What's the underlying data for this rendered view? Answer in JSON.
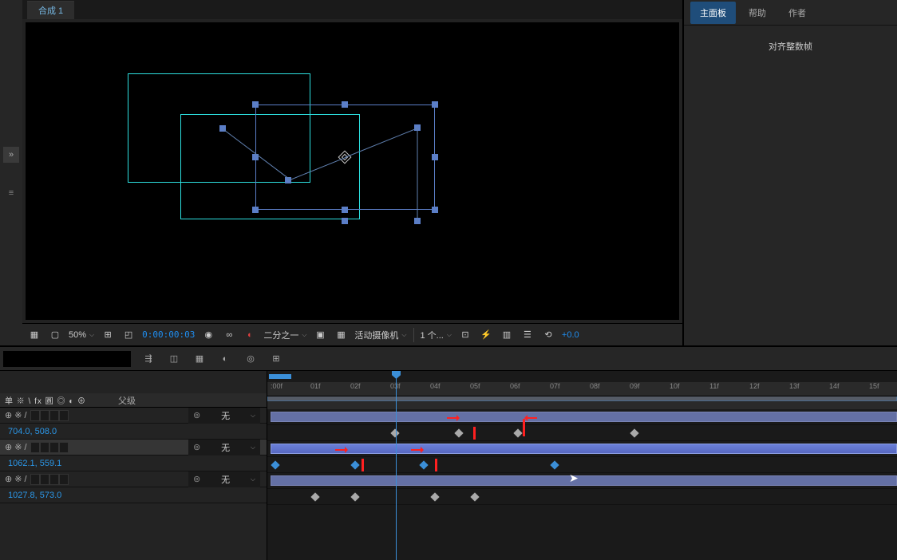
{
  "comp": {
    "tab": "合成 1"
  },
  "toolbar": {
    "zoom": "50%",
    "timecode": "0:00:00:03",
    "resolution": "二分之一",
    "camera": "活动摄像机",
    "views": "1 个...",
    "exposure": "+0.0"
  },
  "rightPanel": {
    "tabs": [
      "主面板",
      "帮助",
      "作者"
    ],
    "btn": "对齐整数帧"
  },
  "timeline": {
    "headers": {
      "switches": "单 ※ \\ fx 圓 ◎ ◐ ⊕",
      "parent": "父级"
    },
    "frames": [
      ":00f",
      "01f",
      "02f",
      "03f",
      "04f",
      "05f",
      "06f",
      "07f",
      "08f",
      "09f",
      "10f",
      "11f",
      "12f",
      "13f",
      "14f",
      "15f"
    ],
    "layers": [
      {
        "parent": "无",
        "pos": "704.0, 508.0"
      },
      {
        "parent": "无",
        "pos": "1062.1, 559.1",
        "selected": true
      },
      {
        "parent": "无",
        "pos": "1027.8, 573.0"
      }
    ]
  }
}
